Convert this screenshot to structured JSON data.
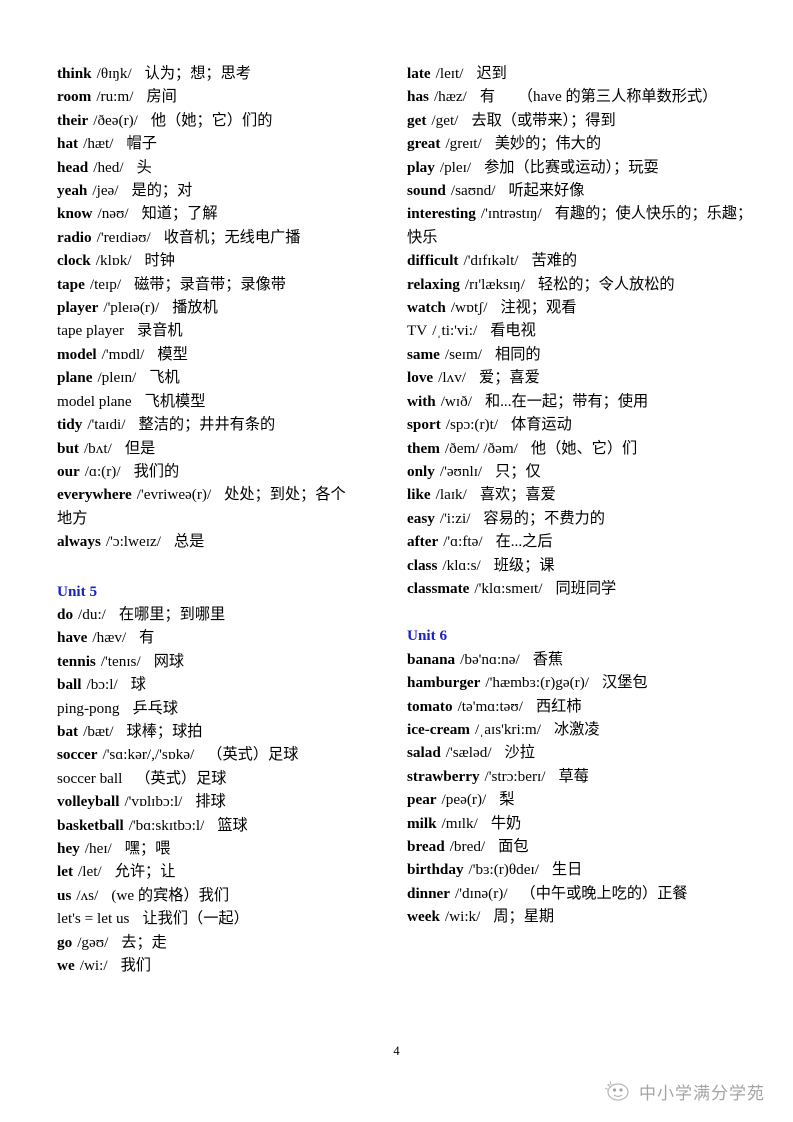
{
  "document": {
    "page_number": "4",
    "unit_head_color": "#1a22c4",
    "watermark": {
      "text": "中小学满分学苑",
      "icon": "cartoon-face-icon"
    }
  },
  "left_column": {
    "entries": [
      {
        "word": "think",
        "phonetic": "/θɪŋk/",
        "meaning": "认为；想；思考"
      },
      {
        "word": "room",
        "phonetic": "/ru:m/",
        "meaning": "房间"
      },
      {
        "word": "their",
        "phonetic": "/ðeə(r)/",
        "meaning": "他（她；它）们的"
      },
      {
        "word": "hat",
        "phonetic": "/hæt/",
        "meaning": "帽子"
      },
      {
        "word": "head",
        "phonetic": "/hed/",
        "meaning": "头"
      },
      {
        "word": "yeah",
        "phonetic": "/jeə/",
        "meaning": "是的；对"
      },
      {
        "word": "know",
        "phonetic": "/nəʊ/",
        "meaning": "知道；了解"
      },
      {
        "word": "radio",
        "phonetic": "/'reɪdiəʊ/",
        "meaning": "收音机；无线电广播"
      },
      {
        "word": "clock",
        "phonetic": "/klɒk/",
        "meaning": "时钟"
      },
      {
        "word": "tape",
        "phonetic": "/teɪp/",
        "meaning": "磁带；录音带；录像带"
      },
      {
        "word": "player",
        "phonetic": "/'pleɪə(r)/",
        "meaning": "播放机"
      },
      {
        "word": "tape player",
        "phonetic": "",
        "meaning": "录音机",
        "bold": false
      },
      {
        "word": "model",
        "phonetic": "/'mɒdl/",
        "meaning": "模型"
      },
      {
        "word": "plane",
        "phonetic": "/pleɪn/",
        "meaning": "飞机"
      },
      {
        "word": "model plane",
        "phonetic": "",
        "meaning": "飞机模型",
        "bold": false
      },
      {
        "word": "tidy",
        "phonetic": "/'taɪdi/",
        "meaning": "整洁的；井井有条的"
      },
      {
        "word": "but",
        "phonetic": "/bʌt/",
        "meaning": "但是"
      },
      {
        "word": "our",
        "phonetic": "/ɑ:(r)/",
        "meaning": "我们的"
      },
      {
        "word": "everywhere",
        "phonetic": "/'evriweə(r)/",
        "meaning": "处处；到处；各个地方"
      },
      {
        "word": "always",
        "phonetic": "/'ɔ:lweɪz/",
        "meaning": "总是"
      }
    ],
    "unit_label": "Unit 5",
    "unit_entries": [
      {
        "word": "do",
        "phonetic": "/du:/",
        "meaning": "在哪里；到哪里"
      },
      {
        "word": "have",
        "phonetic": "/hæv/",
        "meaning": "有"
      },
      {
        "word": "tennis",
        "phonetic": "/'tenɪs/",
        "meaning": "网球"
      },
      {
        "word": "ball",
        "phonetic": "/bɔ:l/",
        "meaning": "球"
      },
      {
        "word": "ping-pong",
        "phonetic": "",
        "meaning": "乒乓球",
        "bold": false
      },
      {
        "word": "bat",
        "phonetic": "/bæt/",
        "meaning": "球棒；球拍"
      },
      {
        "word": "soccer",
        "phonetic": "/'sɑ:kər/,/'sɒkə/",
        "meaning": "（英式）足球"
      },
      {
        "word": "soccer ball",
        "phonetic": "",
        "meaning": "（英式）足球",
        "bold": false
      },
      {
        "word": "volleyball",
        "phonetic": "/'vɒlɪbɔ:l/",
        "meaning": "排球"
      },
      {
        "word": "basketball",
        "phonetic": "/'bɑ:skɪtbɔ:l/",
        "meaning": "篮球"
      },
      {
        "word": "hey",
        "phonetic": "/heɪ/",
        "meaning": "嘿；喂"
      },
      {
        "word": "let",
        "phonetic": "/let/",
        "meaning": "允许；让"
      },
      {
        "word": "us",
        "phonetic": "/ʌs/",
        "meaning": "(we 的宾格）我们"
      },
      {
        "word": "let's = let us",
        "phonetic": "",
        "meaning": "让我们（一起）",
        "bold": false
      },
      {
        "word": "go",
        "phonetic": "/gəʊ/",
        "meaning": "去；走"
      },
      {
        "word": "we",
        "phonetic": "/wi:/",
        "meaning": "我们"
      }
    ]
  },
  "right_column": {
    "entries": [
      {
        "word": "late",
        "phonetic": "/leɪt/",
        "meaning": "迟到"
      },
      {
        "word": "has",
        "phonetic": "/hæz/",
        "meaning": "有　　（have 的第三人称单数形式）"
      },
      {
        "word": "get",
        "phonetic": "/get/",
        "meaning": "去取（或带来）；得到"
      },
      {
        "word": "great",
        "phonetic": "/greɪt/",
        "meaning": "美妙的；伟大的"
      },
      {
        "word": "play",
        "phonetic": "/pleɪ/",
        "meaning": "参加（比赛或运动）；玩耍"
      },
      {
        "word": "sound",
        "phonetic": "/saʊnd/",
        "meaning": "听起来好像"
      },
      {
        "word": "interesting",
        "phonetic": "/'ɪntrəstɪŋ/",
        "meaning": "有趣的；使人快乐的；乐趣；快乐"
      },
      {
        "word": "difficult",
        "phonetic": "/'dɪfɪkəlt/",
        "meaning": "苦难的"
      },
      {
        "word": "relaxing",
        "phonetic": "/rɪ'læksɪŋ/",
        "meaning": "轻松的；令人放松的"
      },
      {
        "word": "watch",
        "phonetic": "/wɒtʃ/",
        "meaning": "注视；观看"
      },
      {
        "word": "TV",
        "phonetic": "/ˌti:'vi:/",
        "meaning": "看电视",
        "bold": false
      },
      {
        "word": "same",
        "phonetic": "/seɪm/",
        "meaning": "相同的"
      },
      {
        "word": "love",
        "phonetic": "/lʌv/",
        "meaning": "爱；喜爱"
      },
      {
        "word": "with",
        "phonetic": "/wɪð/",
        "meaning": "和...在一起；带有；使用"
      },
      {
        "word": "sport",
        "phonetic": "/spɔ:(r)t/",
        "meaning": "体育运动"
      },
      {
        "word": "them",
        "phonetic": "/ðem/ /ðəm/",
        "meaning": "他（她、它）们"
      },
      {
        "word": "only",
        "phonetic": "/'əʊnlɪ/",
        "meaning": "只；仅"
      },
      {
        "word": "like",
        "phonetic": "/laɪk/",
        "meaning": "喜欢；喜爱"
      },
      {
        "word": "easy",
        "phonetic": "/'i:zi/",
        "meaning": "容易的；不费力的"
      },
      {
        "word": "after",
        "phonetic": "/'ɑ:ftə/",
        "meaning": "在...之后"
      },
      {
        "word": "class",
        "phonetic": "/klɑ:s/",
        "meaning": "班级；课"
      },
      {
        "word": "classmate",
        "phonetic": "/'klɑ:smeɪt/",
        "meaning": "同班同学"
      }
    ],
    "unit_label": "Unit 6",
    "unit_entries": [
      {
        "word": "banana",
        "phonetic": "/bə'nɑ:nə/",
        "meaning": "香蕉"
      },
      {
        "word": "hamburger",
        "phonetic": "/'hæmbɜ:(r)gə(r)/",
        "meaning": "汉堡包"
      },
      {
        "word": "tomato",
        "phonetic": "/tə'mɑ:təʊ/",
        "meaning": "西红柿"
      },
      {
        "word": "ice-cream",
        "phonetic": "/ˌaɪs'kri:m/",
        "meaning": "冰激凌"
      },
      {
        "word": "salad",
        "phonetic": "/'sæləd/",
        "meaning": "沙拉"
      },
      {
        "word": "strawberry",
        "phonetic": "/'strɔ:berɪ/",
        "meaning": "草莓"
      },
      {
        "word": "pear",
        "phonetic": "/peə(r)/",
        "meaning": "梨"
      },
      {
        "word": "milk",
        "phonetic": "/mɪlk/",
        "meaning": "牛奶"
      },
      {
        "word": "bread",
        "phonetic": "/bred/",
        "meaning": "面包"
      },
      {
        "word": "birthday",
        "phonetic": "/'bɜ:(r)θdeɪ/",
        "meaning": "生日"
      },
      {
        "word": "dinner",
        "phonetic": "/'dɪnə(r)/",
        "meaning": "（中午或晚上吃的）正餐"
      },
      {
        "word": "week",
        "phonetic": "/wi:k/",
        "meaning": "周；星期"
      }
    ]
  }
}
